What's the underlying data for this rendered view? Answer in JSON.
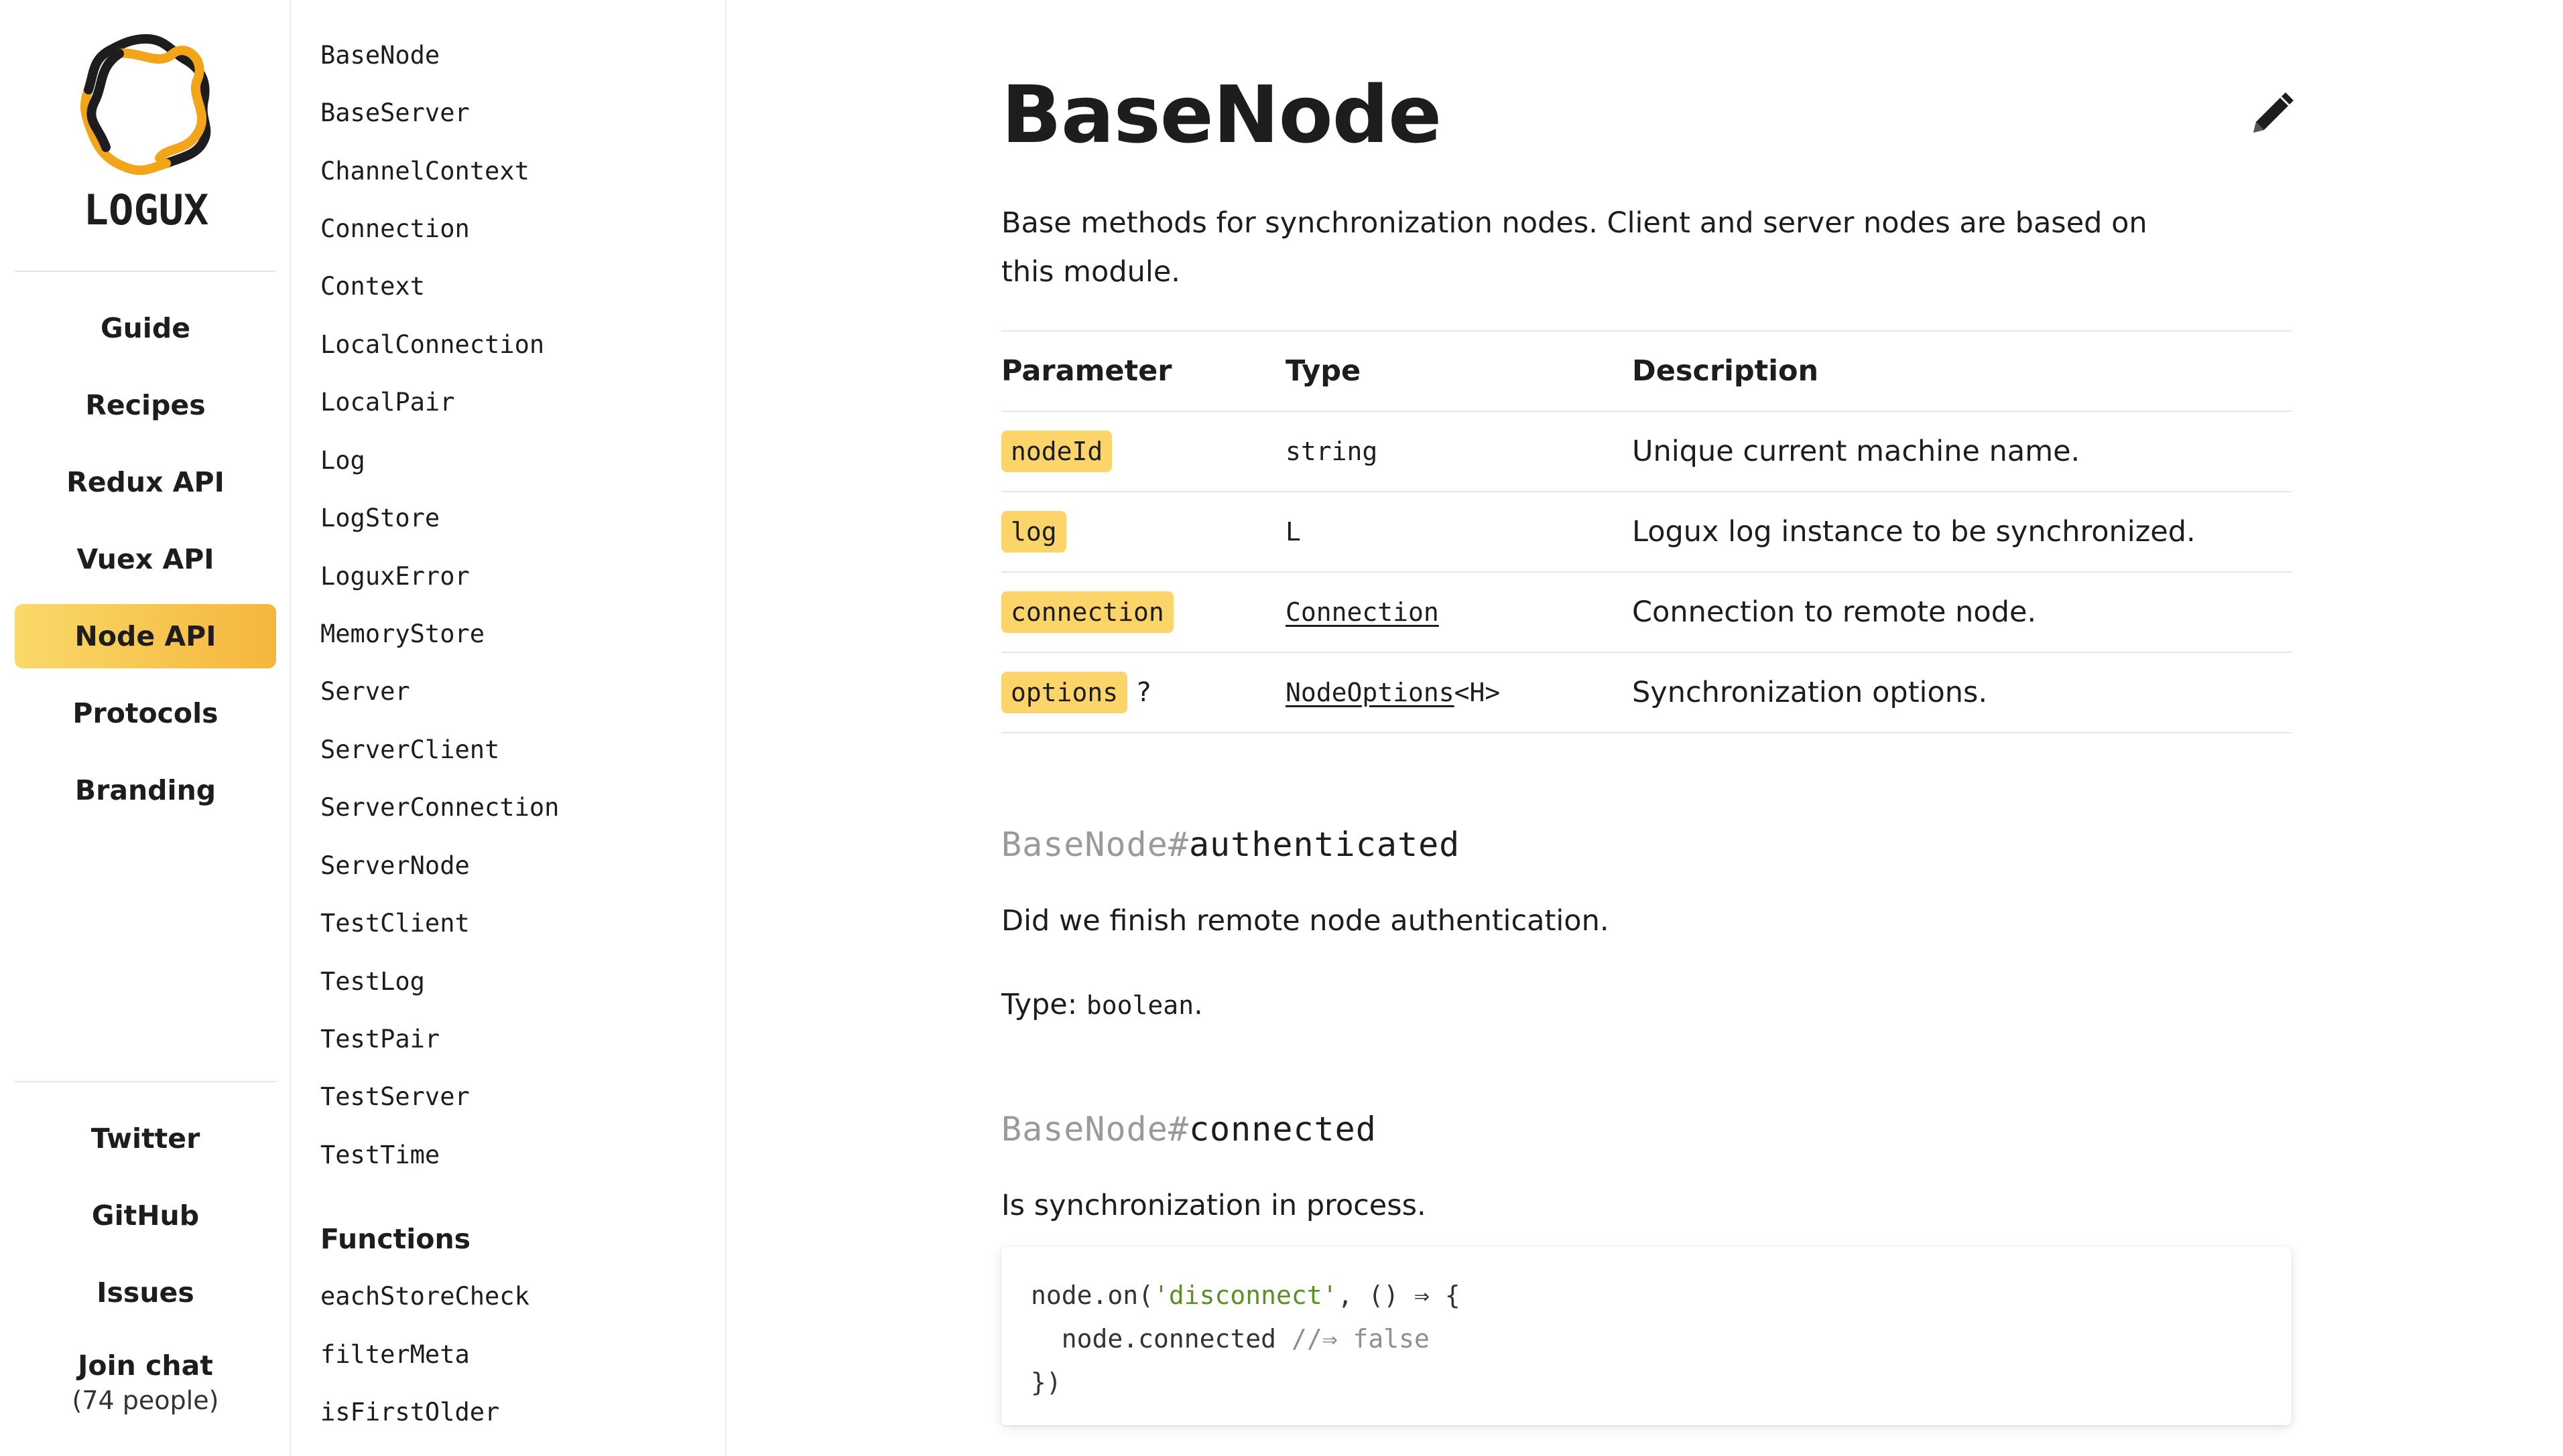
{
  "rail": {
    "logo_text": "LOGUX",
    "nav": [
      "Guide",
      "Recipes",
      "Redux API",
      "Vuex API",
      "Node API",
      "Protocols",
      "Branding"
    ],
    "active": "Node API",
    "footer": [
      "Twitter",
      "GitHub",
      "Issues"
    ],
    "chat": {
      "title": "Join chat",
      "people": "(74 people)"
    }
  },
  "sidebar": {
    "classes": [
      "BaseNode",
      "BaseServer",
      "ChannelContext",
      "Connection",
      "Context",
      "LocalConnection",
      "LocalPair",
      "Log",
      "LogStore",
      "LoguxError",
      "MemoryStore",
      "Server",
      "ServerClient",
      "ServerConnection",
      "ServerNode",
      "TestClient",
      "TestLog",
      "TestPair",
      "TestServer",
      "TestTime"
    ],
    "functions_heading": "Functions",
    "functions": [
      "eachStoreCheck",
      "filterMeta",
      "isFirstOlder"
    ]
  },
  "page": {
    "title": "BaseNode",
    "edit_icon": "pencil-icon",
    "description": "Base methods for synchronization nodes. Client and server nodes are based on this module.",
    "table": {
      "headers": [
        "Parameter",
        "Type",
        "Description"
      ],
      "rows": [
        {
          "param": "nodeId",
          "optional": "",
          "type": "string",
          "type_link": false,
          "desc": "Unique current machine name."
        },
        {
          "param": "log",
          "optional": "",
          "type": "L",
          "type_link": false,
          "desc": "Logux log instance to be synchronized."
        },
        {
          "param": "connection",
          "optional": "",
          "type": "Connection",
          "type_link": true,
          "desc": "Connection to remote node."
        },
        {
          "param": "options",
          "optional": "?",
          "type": "NodeOptions",
          "type_suffix": "<H>",
          "type_link": true,
          "desc": "Synchronization options."
        }
      ]
    },
    "members": [
      {
        "class_prefix": "BaseNode#",
        "name": "authenticated",
        "text": "Did we finish remote node authentication.",
        "type_label": "Type: ",
        "type_value": "boolean",
        "type_end": "."
      },
      {
        "class_prefix": "BaseNode#",
        "name": "connected",
        "text": "Is synchronization in process.",
        "code": {
          "l1_a": "node.on(",
          "l1_str": "'disconnect'",
          "l1_b": ", () ⇒ {",
          "l2_a": "  node.connected ",
          "l2_cm": "//⇒ false",
          "l3": "})"
        }
      }
    ]
  },
  "colors": {
    "accent_start": "#f9d96a",
    "accent_end": "#f5b63c",
    "chip": "#fbd56a",
    "muted": "#9a9a9a",
    "string": "#5e8d2a"
  }
}
